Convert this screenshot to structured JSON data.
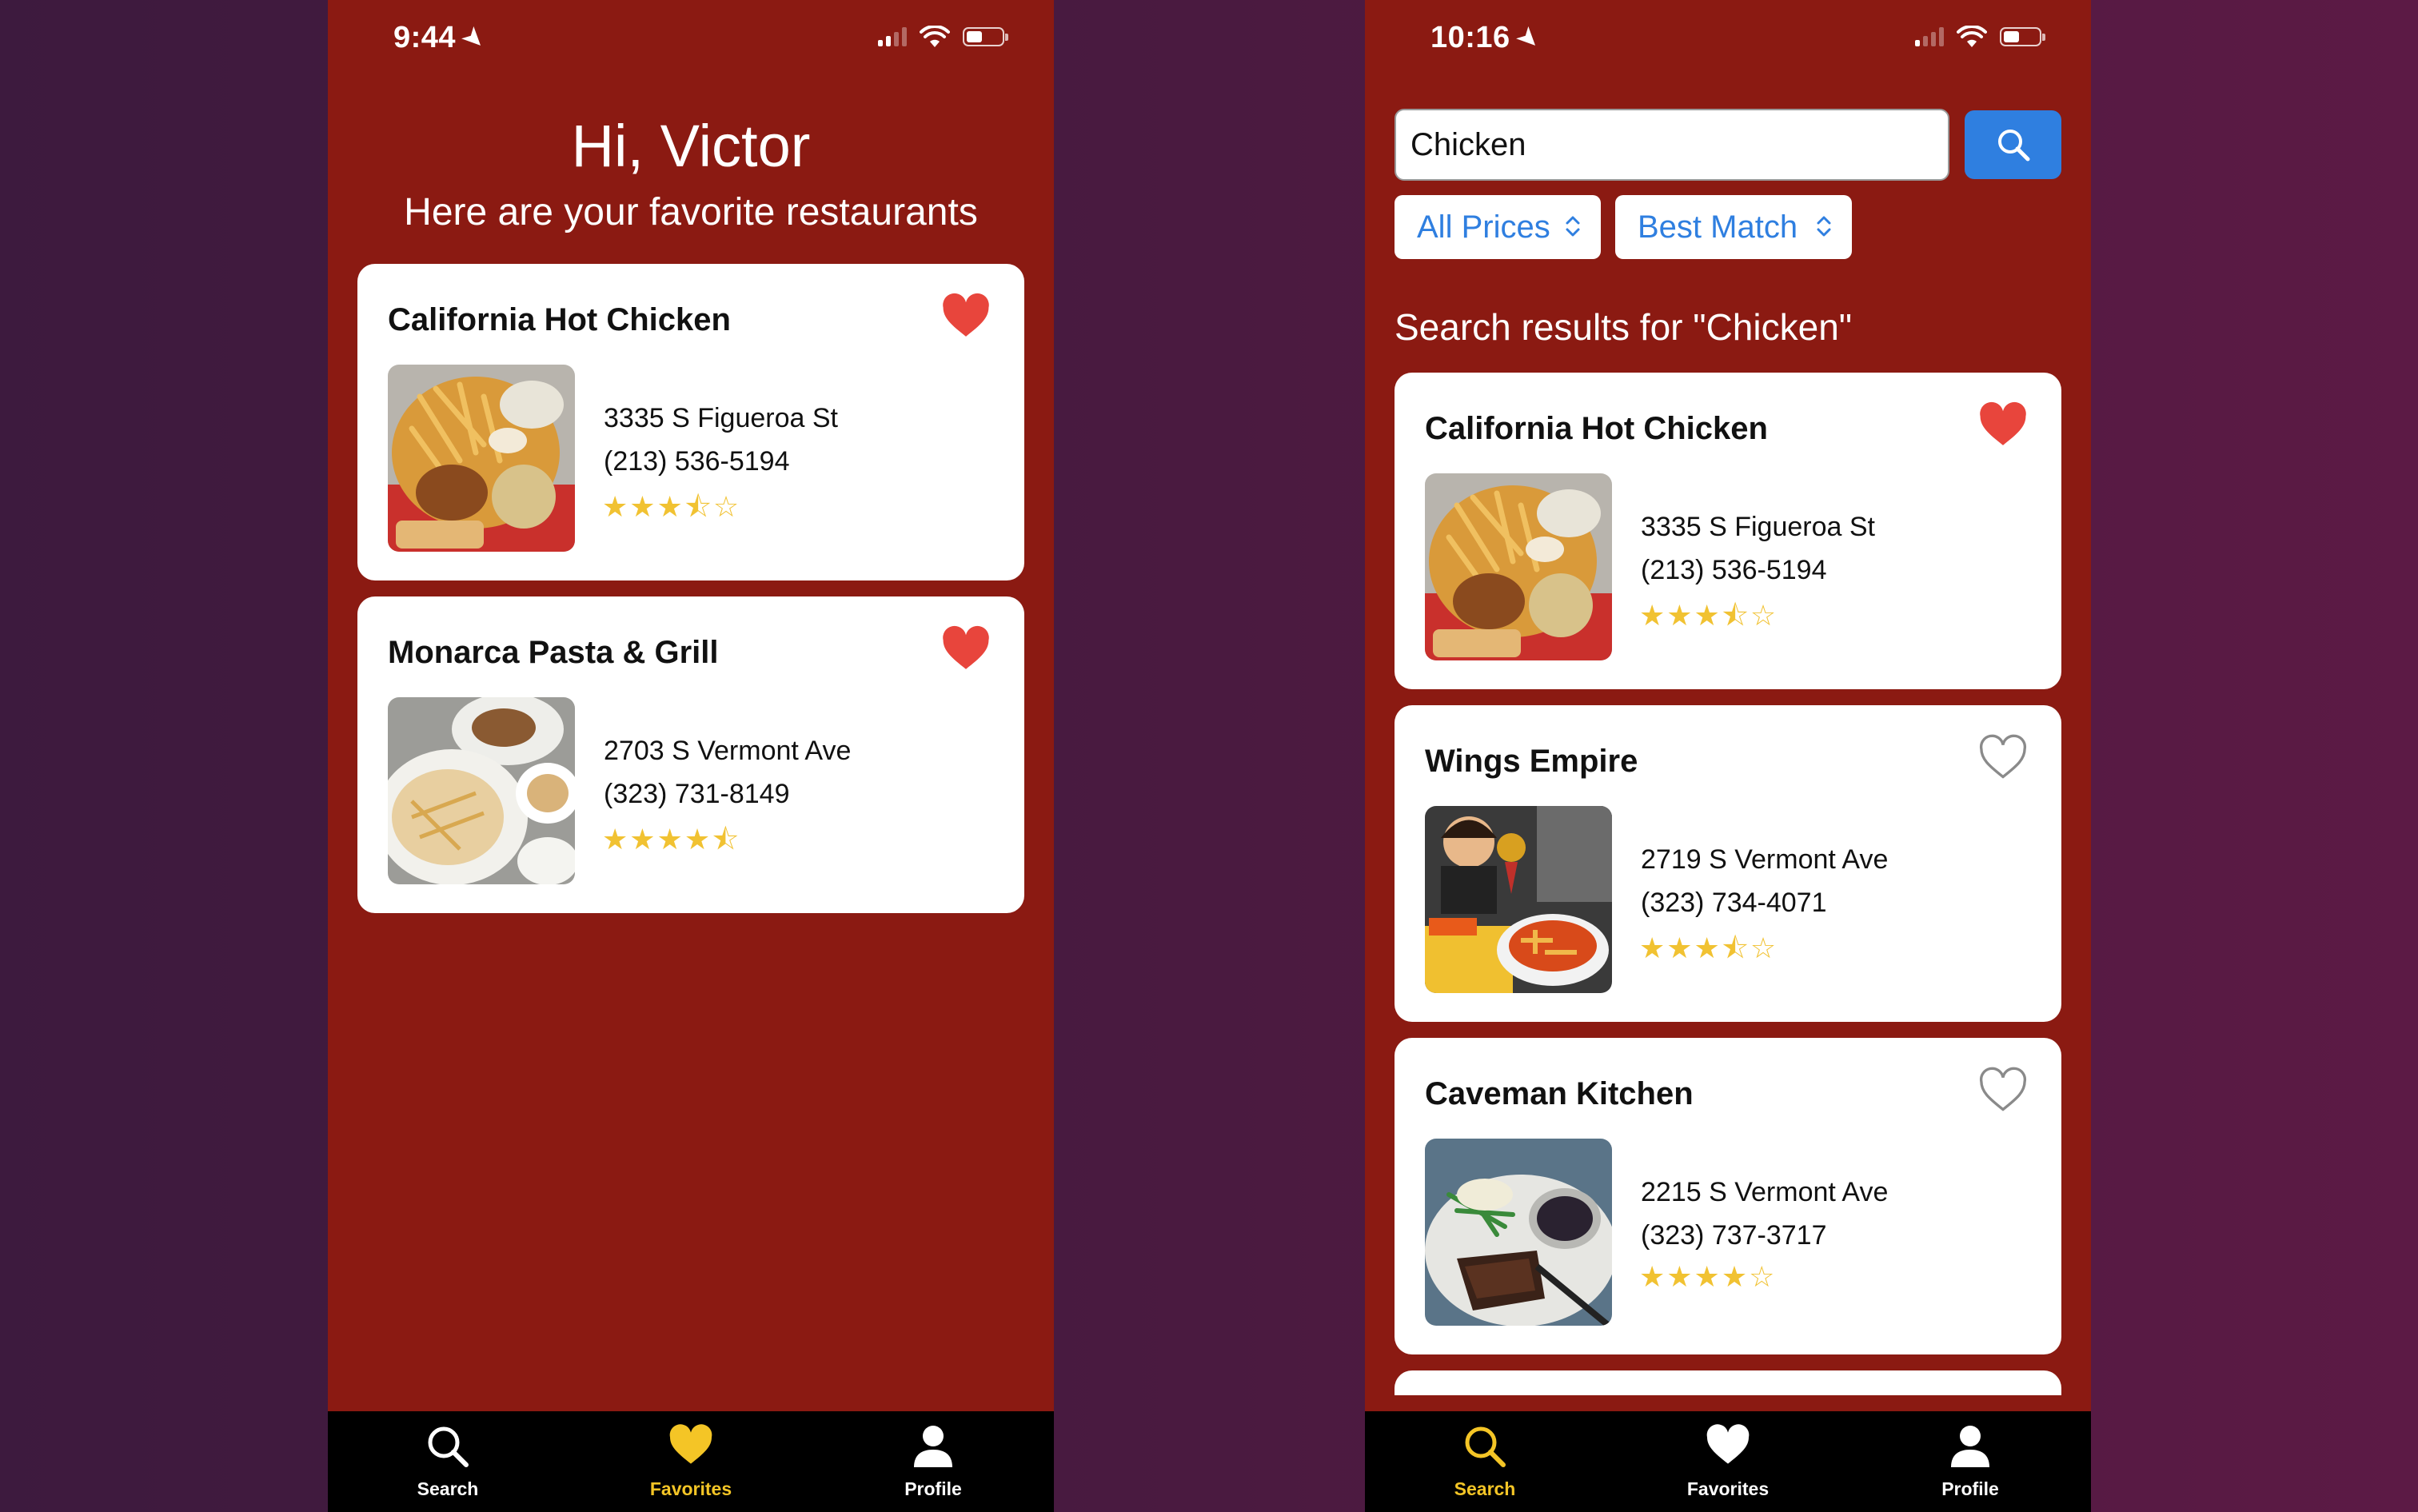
{
  "colors": {
    "app_background": "#8b1a12",
    "accent_blue": "#2f7fe0",
    "active_tab": "#f4c526",
    "heart_filled": "#e8453c",
    "star": "#f1c232"
  },
  "left_screen": {
    "status": {
      "time": "9:44",
      "battery_level": 0.4
    },
    "greeting": {
      "title": "Hi, Victor",
      "subtitle": "Here are your favorite restaurants"
    },
    "restaurants": [
      {
        "name": "California Hot Chicken",
        "address": "3335 S Figueroa St",
        "phone": "(213) 536-5194",
        "rating": 3.5,
        "stars": "★★★⯪☆",
        "favorite": true,
        "icon": "heart-filled-icon"
      },
      {
        "name": "Monarca Pasta & Grill",
        "address": "2703 S Vermont Ave",
        "phone": "(323) 731-8149",
        "rating": 4.5,
        "stars": "★★★★⯪",
        "favorite": true,
        "icon": "heart-filled-icon"
      }
    ],
    "tabs": [
      {
        "label": "Search",
        "icon": "search-icon",
        "active": false
      },
      {
        "label": "Favorites",
        "icon": "heart-icon",
        "active": true
      },
      {
        "label": "Profile",
        "icon": "person-icon",
        "active": false
      }
    ]
  },
  "right_screen": {
    "status": {
      "time": "10:16",
      "battery_level": 0.4
    },
    "search": {
      "value": "Chicken",
      "button_icon": "search-icon"
    },
    "filters": {
      "price": "All Prices",
      "sort": "Best Match"
    },
    "results_heading": "Search results for \"Chicken\"",
    "restaurants": [
      {
        "name": "California Hot Chicken",
        "address": "3335 S Figueroa St",
        "phone": "(213) 536-5194",
        "rating": 3.5,
        "stars": "★★★⯪☆",
        "favorite": true,
        "icon": "heart-filled-icon"
      },
      {
        "name": "Wings Empire",
        "address": "2719 S Vermont Ave",
        "phone": "(323) 734-4071",
        "rating": 3.5,
        "stars": "★★★⯪☆",
        "favorite": false,
        "icon": "heart-outline-icon"
      },
      {
        "name": "Caveman Kitchen",
        "address": "2215 S Vermont Ave",
        "phone": "(323) 737-3717",
        "rating": 4,
        "stars": "★★★★☆",
        "favorite": false,
        "icon": "heart-outline-icon"
      }
    ],
    "tabs": [
      {
        "label": "Search",
        "icon": "search-icon",
        "active": true
      },
      {
        "label": "Favorites",
        "icon": "heart-icon",
        "active": false
      },
      {
        "label": "Profile",
        "icon": "person-icon",
        "active": false
      }
    ]
  }
}
